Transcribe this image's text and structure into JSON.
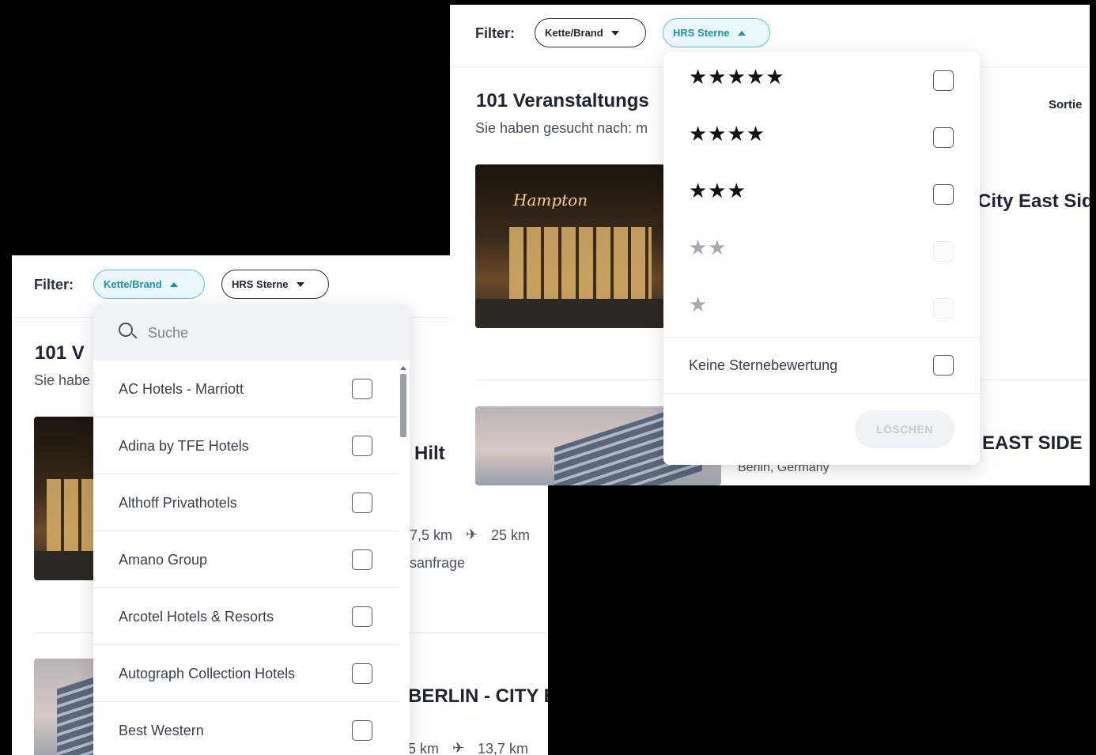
{
  "left": {
    "filter_label": "Filter:",
    "chip_brand": "Kette/Brand",
    "chip_stars": "HRS Sterne",
    "results_title": "101 V",
    "search_text": "Sie habe",
    "hotel1_title": "Hilt",
    "hotel1_dist1": "7,5 km",
    "hotel1_dist2": "25 km",
    "hotel1_request": "sanfrage",
    "hotel2_title": "BERLIN - CITY E",
    "hotel2_dist1": "5 km",
    "hotel2_dist2": "13,7 km",
    "brand_search_placeholder": "Suche",
    "brands": [
      "AC Hotels - Marriott",
      "Adina by TFE Hotels",
      "Althoff Privathotels",
      "Amano Group",
      "Arcotel Hotels & Resorts",
      "Autograph Collection Hotels",
      "Best Western"
    ]
  },
  "right": {
    "filter_label": "Filter:",
    "chip_brand": "Kette/Brand",
    "chip_stars": "HRS Sterne",
    "results_title": "101 Veranstaltungs",
    "search_text": "Sie haben gesucht nach: m",
    "sort_label": "Sortie",
    "hotel1_title": "City East Sid",
    "hotel1_sign": "Hampton",
    "hotel2_title": "EAST SIDE",
    "hotel2_location": "Berlin, Germany",
    "star_options": [
      "★★★★★",
      "★★★★",
      "★★★",
      "★★",
      "★"
    ],
    "no_stars_label": "Keine Sternebewertung",
    "clear_label": "LÖSCHEN"
  }
}
